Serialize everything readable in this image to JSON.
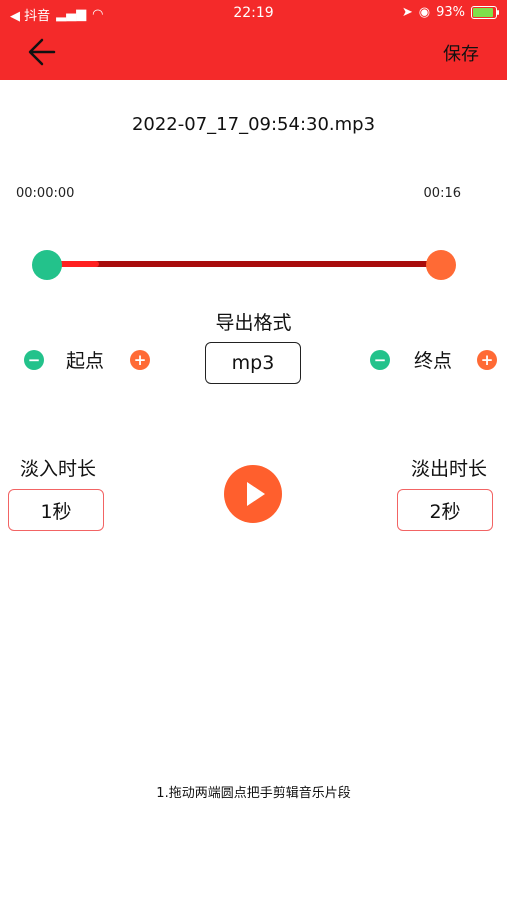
{
  "status": {
    "back_app": "◀ 抖音",
    "time": "22:19",
    "battery": "93%"
  },
  "header": {
    "save_label": "保存"
  },
  "file": {
    "name": "2022-07_17_09:54:30.mp3"
  },
  "timeline": {
    "start_time": "00:00:00",
    "end_time": "00:16",
    "selection_start_fraction": 0,
    "selection_end_fraction": 1
  },
  "format": {
    "label": "导出格式",
    "value": "mp3"
  },
  "controls": {
    "start_label": "起点",
    "end_label": "终点",
    "minus": "−",
    "plus": "+"
  },
  "fade": {
    "in_label": "淡入时长",
    "in_value": "1秒",
    "out_label": "淡出时长",
    "out_value": "2秒"
  },
  "tip": "1.拖动两端圆点把手剪辑音乐片段",
  "colors": {
    "brand_red": "#f42a2a",
    "start_green": "#23c28b",
    "end_orange": "#ff6a35"
  }
}
